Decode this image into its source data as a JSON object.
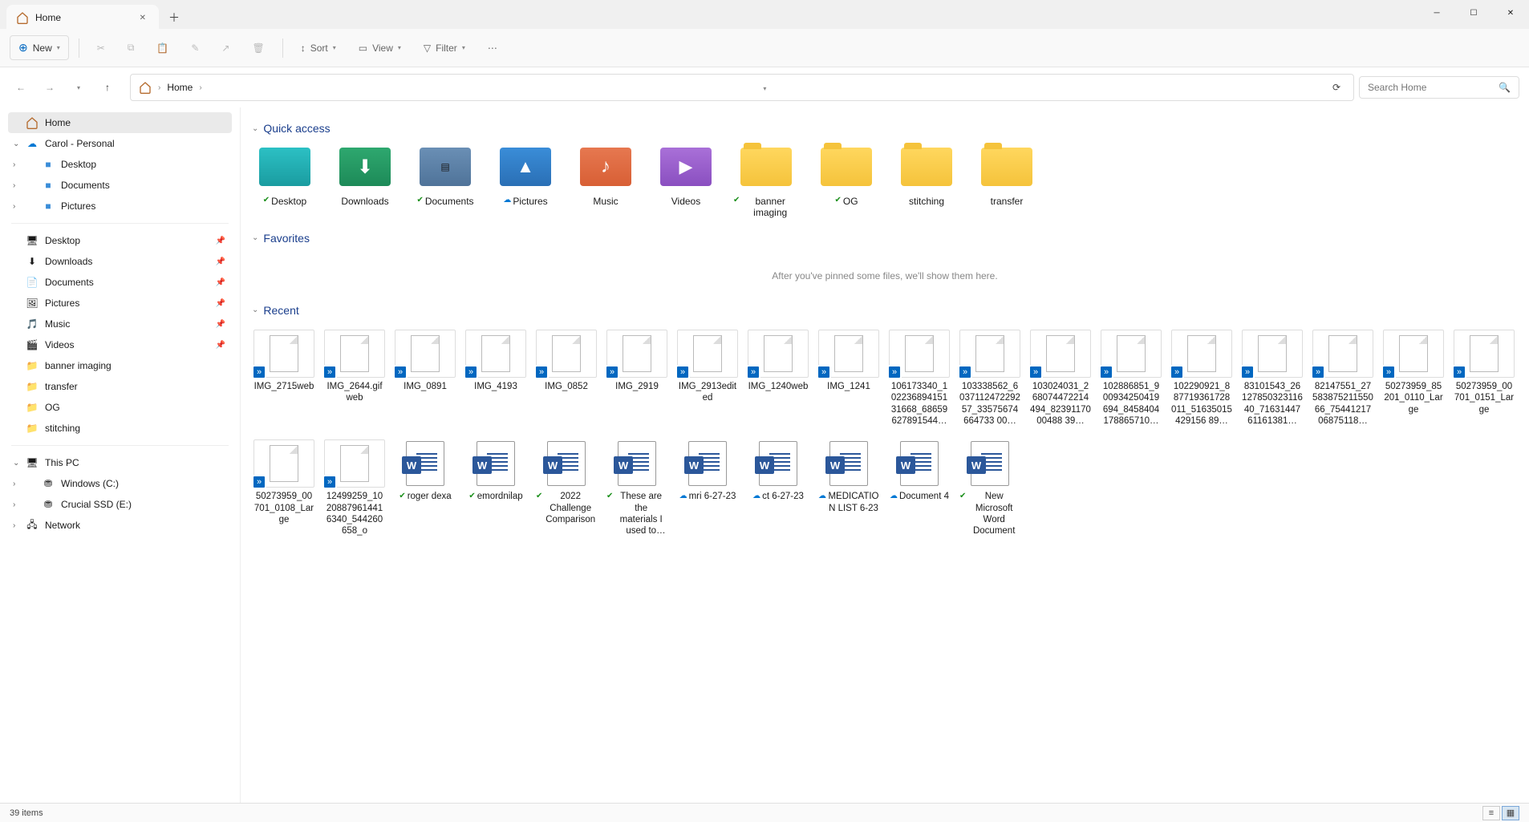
{
  "tab": {
    "title": "Home"
  },
  "toolbar": {
    "new": "New",
    "sort": "Sort",
    "view": "View",
    "filter": "Filter"
  },
  "breadcrumb": {
    "home": "Home"
  },
  "search": {
    "placeholder": "Search Home"
  },
  "sidebar": {
    "home": "Home",
    "personal": "Carol - Personal",
    "personal_children": [
      "Desktop",
      "Documents",
      "Pictures"
    ],
    "pinned": [
      {
        "label": "Desktop",
        "icon": "desktop"
      },
      {
        "label": "Downloads",
        "icon": "downloads"
      },
      {
        "label": "Documents",
        "icon": "documents"
      },
      {
        "label": "Pictures",
        "icon": "pictures"
      },
      {
        "label": "Music",
        "icon": "music"
      },
      {
        "label": "Videos",
        "icon": "videos"
      },
      {
        "label": "banner imaging",
        "icon": "folder"
      },
      {
        "label": "transfer",
        "icon": "folder"
      },
      {
        "label": "OG",
        "icon": "folder"
      },
      {
        "label": "stitching",
        "icon": "folder"
      }
    ],
    "thispc": "This PC",
    "drives": [
      "Windows  (C:)",
      "Crucial SSD (E:)"
    ],
    "network": "Network"
  },
  "sections": {
    "quick_access": "Quick access",
    "favorites": "Favorites",
    "recent": "Recent"
  },
  "quick_access": [
    {
      "label": "Desktop",
      "type": "teal",
      "badge": "green-check"
    },
    {
      "label": "Downloads",
      "type": "green",
      "badge": ""
    },
    {
      "label": "Documents",
      "type": "blue",
      "badge": "green-check"
    },
    {
      "label": "Pictures",
      "type": "pic",
      "badge": "blue-cloud"
    },
    {
      "label": "Music",
      "type": "music",
      "badge": ""
    },
    {
      "label": "Videos",
      "type": "video",
      "badge": ""
    },
    {
      "label": "banner imaging",
      "type": "yellow",
      "badge": "green-check"
    },
    {
      "label": "OG",
      "type": "yellow",
      "badge": "green-check"
    },
    {
      "label": "stitching",
      "type": "yellow",
      "badge": ""
    },
    {
      "label": "transfer",
      "type": "yellow",
      "badge": ""
    }
  ],
  "favorites_empty": "After you've pinned some files, we'll show them here.",
  "recent": [
    {
      "label": "IMG_2715web",
      "kind": "paper",
      "badge": "arrow"
    },
    {
      "label": "IMG_2644.gifweb",
      "kind": "paper",
      "badge": "arrow"
    },
    {
      "label": "IMG_0891",
      "kind": "paper",
      "badge": "arrow"
    },
    {
      "label": "IMG_4193",
      "kind": "paper",
      "badge": "arrow"
    },
    {
      "label": "IMG_0852",
      "kind": "paper",
      "badge": "arrow"
    },
    {
      "label": "IMG_2919",
      "kind": "paper",
      "badge": "arrow"
    },
    {
      "label": "IMG_2913edited",
      "kind": "paper",
      "badge": "arrow"
    },
    {
      "label": "IMG_1240web",
      "kind": "paper",
      "badge": "arrow"
    },
    {
      "label": "IMG_1241",
      "kind": "paper",
      "badge": "arrow"
    },
    {
      "label": "106173340_10223689415131668_68659627891544…",
      "kind": "paper",
      "badge": "arrow"
    },
    {
      "label": "103338562_603711247229257_33575674664733 00…",
      "kind": "paper",
      "badge": "arrow"
    },
    {
      "label": "103024031_268074472214494_8239117000488 39…",
      "kind": "paper",
      "badge": "arrow"
    },
    {
      "label": "102886851_900934250419694_8458404178865710…",
      "kind": "paper",
      "badge": "arrow"
    },
    {
      "label": "102290921_887719361728011_51635015429156 89…",
      "kind": "paper",
      "badge": "arrow"
    },
    {
      "label": "83101543_2612785032311640_7163144761161381…",
      "kind": "paper",
      "badge": "arrow"
    },
    {
      "label": "82147551_2758387521155066_7544121706875118…",
      "kind": "paper",
      "badge": "arrow"
    },
    {
      "label": "50273959_85201_0110_Large",
      "kind": "paper",
      "badge": "arrow"
    },
    {
      "label": "50273959_00701_0151_Large",
      "kind": "paper",
      "badge": "arrow"
    },
    {
      "label": "50273959_00701_0108_Large",
      "kind": "paper",
      "badge": "arrow"
    },
    {
      "label": "12499259_1020887961441 6340_544260658_o",
      "kind": "paper",
      "badge": "arrow"
    },
    {
      "label": "roger dexa",
      "kind": "word",
      "badge": "green-check"
    },
    {
      "label": "emordnilap",
      "kind": "word",
      "badge": "green-check"
    },
    {
      "label": "2022 Challenge Comparison",
      "kind": "word",
      "badge": "green-check"
    },
    {
      "label": "These are the materials I used to make the n…",
      "kind": "word",
      "badge": "green-check"
    },
    {
      "label": "mri 6-27-23",
      "kind": "word",
      "badge": "blue-cloud"
    },
    {
      "label": "ct 6-27-23",
      "kind": "word",
      "badge": "blue-cloud"
    },
    {
      "label": "MEDICATION LIST 6-23",
      "kind": "word",
      "badge": "blue-cloud"
    },
    {
      "label": "Document 4",
      "kind": "word",
      "badge": "blue-cloud"
    },
    {
      "label": "New Microsoft Word Document",
      "kind": "word",
      "badge": "green-check"
    }
  ],
  "status": {
    "items": "39 items"
  }
}
